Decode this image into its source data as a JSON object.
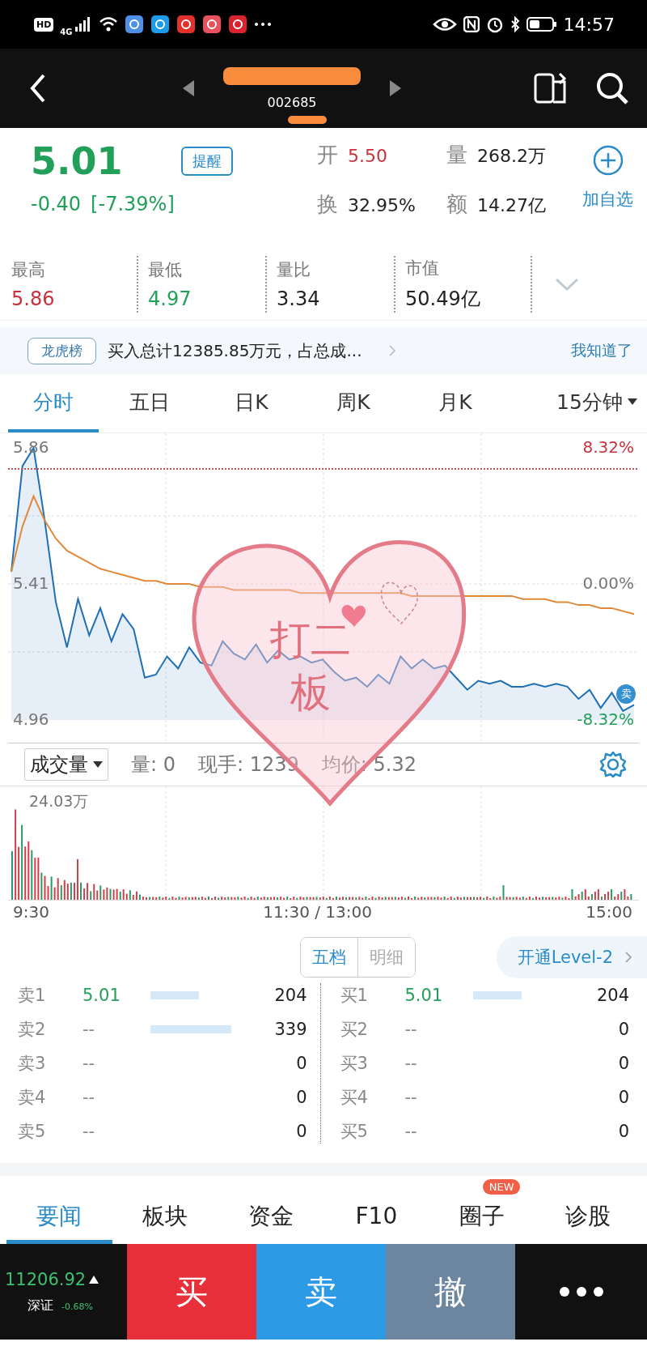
{
  "status_bar": {
    "hd": "HD",
    "network": "4G",
    "time": "14:57"
  },
  "nav": {
    "code": "002685"
  },
  "quote": {
    "price": "5.01",
    "change": "-0.40",
    "change_pct": "[-7.39%]",
    "color": "#22a05a",
    "alert_button": "提醒",
    "watchlist": "加自选",
    "stats": [
      {
        "label": "开",
        "value": "5.50",
        "color": "#c8323c"
      },
      {
        "label": "量",
        "value": "268.2万",
        "color": "#222222"
      },
      {
        "label": "换",
        "value": "32.95%",
        "color": "#222222"
      },
      {
        "label": "额",
        "value": "14.27亿",
        "color": "#222222"
      }
    ]
  },
  "details": [
    {
      "label": "最高",
      "value": "5.86",
      "color": "#c8323c"
    },
    {
      "label": "最低",
      "value": "4.97",
      "color": "#22a05a"
    },
    {
      "label": "量比",
      "value": "3.34",
      "color": "#222222"
    },
    {
      "label": "市值",
      "value": "50.49亿",
      "color": "#222222"
    }
  ],
  "notice": {
    "tag": "龙虎榜",
    "text": "买入总计12385.85万元，占总成...",
    "dismiss": "我知道了"
  },
  "periods": [
    {
      "label": "分时",
      "selected": true,
      "kind": "tab"
    },
    {
      "label": "五日",
      "selected": false,
      "kind": "tab"
    },
    {
      "label": "日K",
      "selected": false,
      "kind": "tab"
    },
    {
      "label": "周K",
      "selected": false,
      "kind": "tab"
    },
    {
      "label": "月K",
      "selected": false,
      "kind": "tab"
    },
    {
      "label": "15分钟",
      "selected": false,
      "kind": "dropdown"
    }
  ],
  "chart": {
    "pct_ticks": [
      "8.32%",
      "0.00%",
      "-8.32%"
    ],
    "sell_marker": "卖",
    "chart_data": {
      "type": "area",
      "grid": true,
      "ylim": [
        4.96,
        5.86
      ],
      "yticks": [
        {
          "value": 5.86,
          "label": "5.86"
        },
        {
          "value": 5.41,
          "label": "5.41"
        },
        {
          "value": 4.96,
          "label": "4.96"
        }
      ],
      "series": [
        {
          "color": "#1f6fb5",
          "values": [
            5.45,
            5.8,
            5.86,
            5.62,
            5.35,
            5.2,
            5.36,
            5.24,
            5.33,
            5.22,
            5.31,
            5.26,
            5.1,
            5.11,
            5.17,
            5.13,
            5.2,
            5.15,
            5.14,
            5.22,
            5.18,
            5.16,
            5.21,
            5.15,
            5.19,
            5.16,
            5.17,
            5.15,
            5.16,
            5.12,
            5.09,
            5.1,
            5.07,
            5.11,
            5.08,
            5.17,
            5.13,
            5.16,
            5.13,
            5.14,
            5.1,
            5.06,
            5.09,
            5.08,
            5.09,
            5.07,
            5.07,
            5.08,
            5.07,
            5.08,
            5.07,
            5.03,
            5.06,
            5.0,
            5.05,
            4.99,
            5.01
          ]
        },
        {
          "color": "#e0893a",
          "type": "line",
          "values": [
            5.45,
            5.6,
            5.7,
            5.62,
            5.56,
            5.52,
            5.5,
            5.48,
            5.46,
            5.45,
            5.44,
            5.43,
            5.42,
            5.42,
            5.41,
            5.41,
            5.41,
            5.4,
            5.4,
            5.4,
            5.39,
            5.39,
            5.39,
            5.39,
            5.39,
            5.39,
            5.38,
            5.38,
            5.38,
            5.38,
            5.38,
            5.38,
            5.38,
            5.38,
            5.38,
            5.38,
            5.37,
            5.37,
            5.37,
            5.37,
            5.37,
            5.37,
            5.37,
            5.37,
            5.37,
            5.37,
            5.36,
            5.36,
            5.36,
            5.35,
            5.35,
            5.34,
            5.34,
            5.33,
            5.33,
            5.32,
            5.31
          ]
        }
      ]
    }
  },
  "volume": {
    "selector": "成交量",
    "stats": [
      "量: 0",
      "现手: 1239",
      "均价: 5.32"
    ],
    "max_label": "24.03万",
    "times": [
      "9:30",
      "11:30 / 13:00",
      "15:00"
    ]
  },
  "sticker": {
    "text": "打二板"
  },
  "book": {
    "tabs": [
      {
        "label": "五档",
        "selected": true
      },
      {
        "label": "明细",
        "selected": false
      }
    ],
    "upgrade": "开通Level-2",
    "sell": [
      {
        "label": "卖1",
        "price": "5.01",
        "volume": "204"
      },
      {
        "label": "卖2",
        "price": "--",
        "volume": "339"
      },
      {
        "label": "卖3",
        "price": "--",
        "volume": "0"
      },
      {
        "label": "卖4",
        "price": "--",
        "volume": "0"
      },
      {
        "label": "卖5",
        "price": "--",
        "volume": "0"
      }
    ],
    "buy": [
      {
        "label": "买1",
        "price": "5.01",
        "volume": "204"
      },
      {
        "label": "买2",
        "price": "--",
        "volume": "0"
      },
      {
        "label": "买3",
        "price": "--",
        "volume": "0"
      },
      {
        "label": "买4",
        "price": "--",
        "volume": "0"
      },
      {
        "label": "买5",
        "price": "--",
        "volume": "0"
      }
    ]
  },
  "news_tabs": [
    {
      "label": "要闻",
      "selected": true
    },
    {
      "label": "板块",
      "selected": false
    },
    {
      "label": "资金",
      "selected": false
    },
    {
      "label": "F10",
      "selected": false
    },
    {
      "label": "圈子",
      "selected": false,
      "badge": "NEW"
    },
    {
      "label": "诊股",
      "selected": false
    }
  ],
  "trade_bar": {
    "index_value": "11206.92",
    "index_name": "深证",
    "index_change": "-0.68%",
    "buttons": [
      {
        "label": "买",
        "kind": "buy"
      },
      {
        "label": "卖",
        "kind": "sell"
      },
      {
        "label": "撤",
        "kind": "cancel"
      }
    ]
  }
}
